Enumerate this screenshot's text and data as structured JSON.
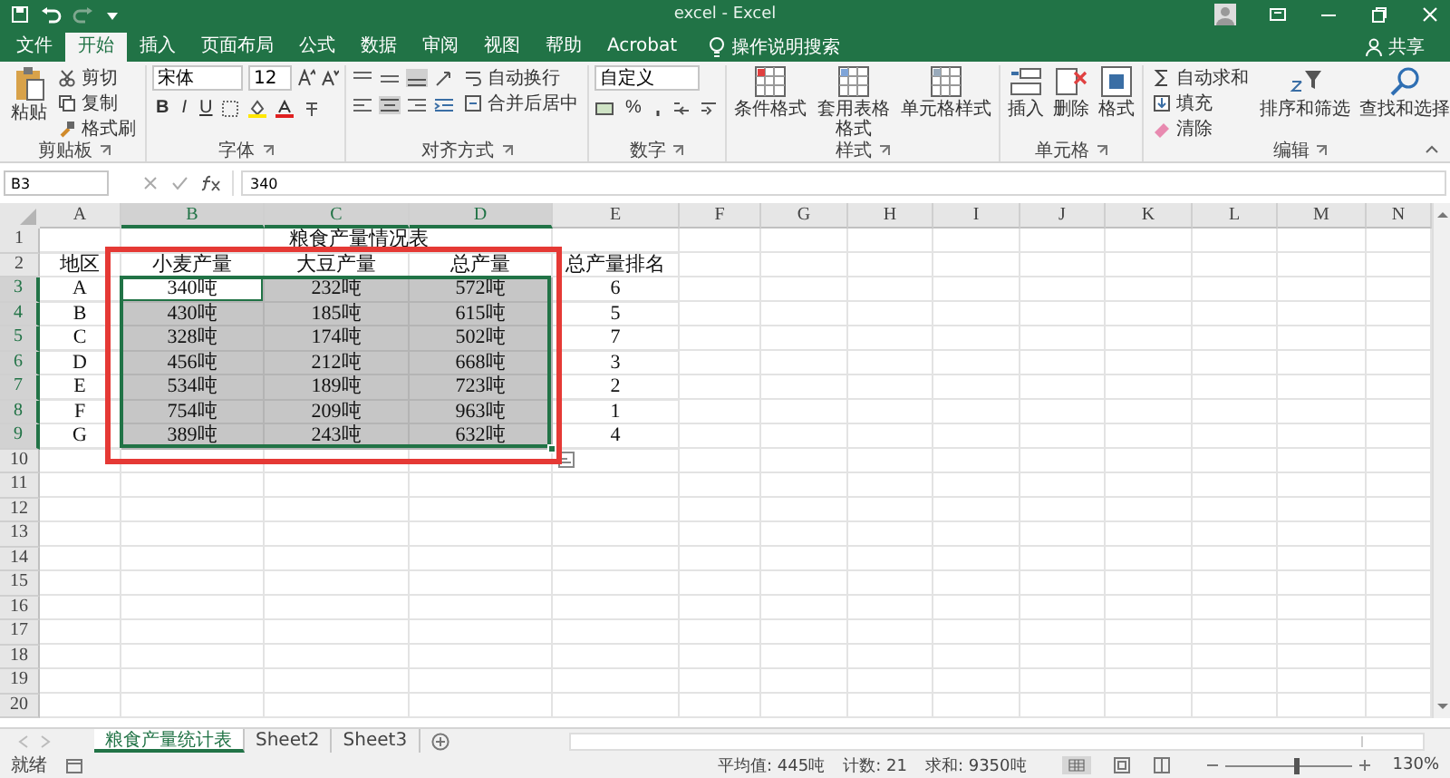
{
  "window": {
    "title": "excel  -  Excel"
  },
  "share": "共享",
  "tabs": [
    {
      "label": "文件",
      "selected": false
    },
    {
      "label": "开始",
      "selected": true
    },
    {
      "label": "插入",
      "selected": false
    },
    {
      "label": "页面布局",
      "selected": false
    },
    {
      "label": "公式",
      "selected": false
    },
    {
      "label": "数据",
      "selected": false
    },
    {
      "label": "审阅",
      "selected": false
    },
    {
      "label": "视图",
      "selected": false
    },
    {
      "label": "帮助",
      "selected": false
    },
    {
      "label": "Acrobat",
      "selected": false
    }
  ],
  "tell_me": {
    "placeholder": "操作说明搜索"
  },
  "ribbon": {
    "clipboard": {
      "label": "剪贴板",
      "paste": "粘贴",
      "items": [
        "剪切",
        "复制",
        "格式刷"
      ]
    },
    "font": {
      "label": "字体",
      "font_name": "宋体",
      "font_size": "12",
      "styles": [
        "B",
        "I",
        "U"
      ]
    },
    "alignment": {
      "label": "对齐方式",
      "items": [
        "自动换行",
        "合并后居中"
      ]
    },
    "number": {
      "label": "数字",
      "format": "自定义",
      "percent": "%"
    },
    "styles": {
      "label": "样式",
      "items": [
        "条件格式",
        "套用表格格式",
        "单元格样式"
      ]
    },
    "cells": {
      "label": "单元格",
      "items": [
        "插入",
        "删除",
        "格式"
      ]
    },
    "editing": {
      "label": "编辑",
      "items": [
        "自动求和",
        "填充",
        "清除"
      ],
      "large": [
        "排序和筛选",
        "查找和选择"
      ]
    }
  },
  "formula_bar": {
    "name_box": "B3",
    "value": "340"
  },
  "sheet": {
    "columns": [
      {
        "label": "A",
        "selected": false
      },
      {
        "label": "B",
        "selected": true
      },
      {
        "label": "C",
        "selected": true
      },
      {
        "label": "D",
        "selected": true
      },
      {
        "label": "E",
        "selected": false
      },
      {
        "label": "F",
        "selected": false
      },
      {
        "label": "G",
        "selected": false
      },
      {
        "label": "H",
        "selected": false
      },
      {
        "label": "I",
        "selected": false
      },
      {
        "label": "J",
        "selected": false
      },
      {
        "label": "K",
        "selected": false
      },
      {
        "label": "L",
        "selected": false
      },
      {
        "label": "M",
        "selected": false
      },
      {
        "label": "N",
        "selected": false
      }
    ],
    "title": "粮食产量情况表",
    "rows": [
      {
        "label": "1",
        "selected": false,
        "cells": []
      },
      {
        "label": "2",
        "selected": false,
        "cells": [
          {
            "text": "地区",
            "selected": false,
            "active": false
          },
          {
            "text": "小麦产量",
            "selected": false,
            "active": false
          },
          {
            "text": "大豆产量",
            "selected": false,
            "active": false
          },
          {
            "text": "总产量",
            "selected": false,
            "active": false
          },
          {
            "text": "总产量排名",
            "selected": false,
            "active": false
          }
        ]
      },
      {
        "label": "3",
        "selected": true,
        "cells": [
          {
            "text": "A",
            "selected": false,
            "active": false
          },
          {
            "text": "340吨",
            "selected": true,
            "active": true
          },
          {
            "text": "232吨",
            "selected": true,
            "active": false
          },
          {
            "text": "572吨",
            "selected": true,
            "active": false
          },
          {
            "text": "6",
            "selected": false,
            "active": false
          }
        ]
      },
      {
        "label": "4",
        "selected": true,
        "cells": [
          {
            "text": "B",
            "selected": false,
            "active": false
          },
          {
            "text": "430吨",
            "selected": true,
            "active": false
          },
          {
            "text": "185吨",
            "selected": true,
            "active": false
          },
          {
            "text": "615吨",
            "selected": true,
            "active": false
          },
          {
            "text": "5",
            "selected": false,
            "active": false
          }
        ]
      },
      {
        "label": "5",
        "selected": true,
        "cells": [
          {
            "text": "C",
            "selected": false,
            "active": false
          },
          {
            "text": "328吨",
            "selected": true,
            "active": false
          },
          {
            "text": "174吨",
            "selected": true,
            "active": false
          },
          {
            "text": "502吨",
            "selected": true,
            "active": false
          },
          {
            "text": "7",
            "selected": false,
            "active": false
          }
        ]
      },
      {
        "label": "6",
        "selected": true,
        "cells": [
          {
            "text": "D",
            "selected": false,
            "active": false
          },
          {
            "text": "456吨",
            "selected": true,
            "active": false
          },
          {
            "text": "212吨",
            "selected": true,
            "active": false
          },
          {
            "text": "668吨",
            "selected": true,
            "active": false
          },
          {
            "text": "3",
            "selected": false,
            "active": false
          }
        ]
      },
      {
        "label": "7",
        "selected": true,
        "cells": [
          {
            "text": "E",
            "selected": false,
            "active": false
          },
          {
            "text": "534吨",
            "selected": true,
            "active": false
          },
          {
            "text": "189吨",
            "selected": true,
            "active": false
          },
          {
            "text": "723吨",
            "selected": true,
            "active": false
          },
          {
            "text": "2",
            "selected": false,
            "active": false
          }
        ]
      },
      {
        "label": "8",
        "selected": true,
        "cells": [
          {
            "text": "F",
            "selected": false,
            "active": false
          },
          {
            "text": "754吨",
            "selected": true,
            "active": false
          },
          {
            "text": "209吨",
            "selected": true,
            "active": false
          },
          {
            "text": "963吨",
            "selected": true,
            "active": false
          },
          {
            "text": "1",
            "selected": false,
            "active": false
          }
        ]
      },
      {
        "label": "9",
        "selected": true,
        "cells": [
          {
            "text": "G",
            "selected": false,
            "active": false
          },
          {
            "text": "389吨",
            "selected": true,
            "active": false
          },
          {
            "text": "243吨",
            "selected": true,
            "active": false
          },
          {
            "text": "632吨",
            "selected": true,
            "active": false
          },
          {
            "text": "4",
            "selected": false,
            "active": false
          }
        ]
      },
      {
        "label": "10",
        "selected": false,
        "cells": []
      },
      {
        "label": "11",
        "selected": false,
        "cells": []
      },
      {
        "label": "12",
        "selected": false,
        "cells": []
      },
      {
        "label": "13",
        "selected": false,
        "cells": []
      },
      {
        "label": "14",
        "selected": false,
        "cells": []
      },
      {
        "label": "15",
        "selected": false,
        "cells": []
      },
      {
        "label": "16",
        "selected": false,
        "cells": []
      },
      {
        "label": "17",
        "selected": false,
        "cells": []
      },
      {
        "label": "18",
        "selected": false,
        "cells": []
      },
      {
        "label": "19",
        "selected": false,
        "cells": []
      },
      {
        "label": "20",
        "selected": false,
        "cells": []
      }
    ],
    "annotation": {
      "kind": "frame"
    }
  },
  "sheet_tabs": [
    {
      "label": "粮食产量统计表",
      "selected": true
    },
    {
      "label": "Sheet2",
      "selected": false
    },
    {
      "label": "Sheet3",
      "selected": false
    }
  ],
  "status_bar": {
    "mode": "就绪",
    "stats": [
      "平均值: 445吨",
      "计数: 21",
      "求和: 9350吨"
    ],
    "zoom": {
      "level": 0.55,
      "reading": "130%"
    }
  }
}
